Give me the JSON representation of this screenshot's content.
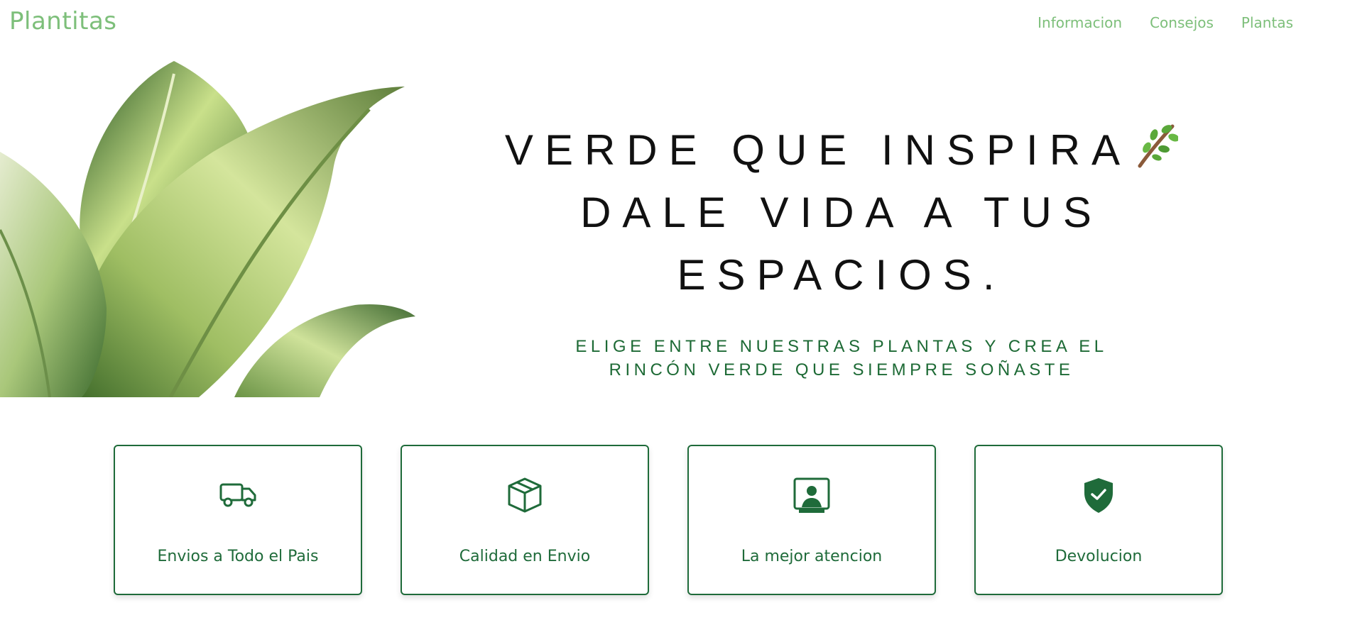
{
  "header": {
    "brand": "Plantitas",
    "nav": [
      {
        "label": "Informacion"
      },
      {
        "label": "Consejos"
      },
      {
        "label": "Plantas"
      }
    ]
  },
  "hero": {
    "headline_lines": [
      "VERDE QUE INSPIRA",
      "DALE VIDA A TUS",
      "ESPACIOS."
    ],
    "headline_icon": "sprig-icon",
    "subline_lines": [
      "ELIGE ENTRE NUESTRAS PLANTAS Y CREA EL",
      "RINCÓN VERDE QUE SIEMPRE SOÑASTE"
    ],
    "image": "dieffenbachia-leaves"
  },
  "features": [
    {
      "label": "Envios a Todo el Pais",
      "icon": "truck-icon"
    },
    {
      "label": "Calidad en Envio",
      "icon": "box-icon"
    },
    {
      "label": "La mejor atencion",
      "icon": "support-user-icon"
    },
    {
      "label": "Devolucion",
      "icon": "shield-check-icon"
    }
  ],
  "colors": {
    "brand": "#7dbf7a",
    "accent": "#1f6b3a",
    "headline": "#111111"
  }
}
